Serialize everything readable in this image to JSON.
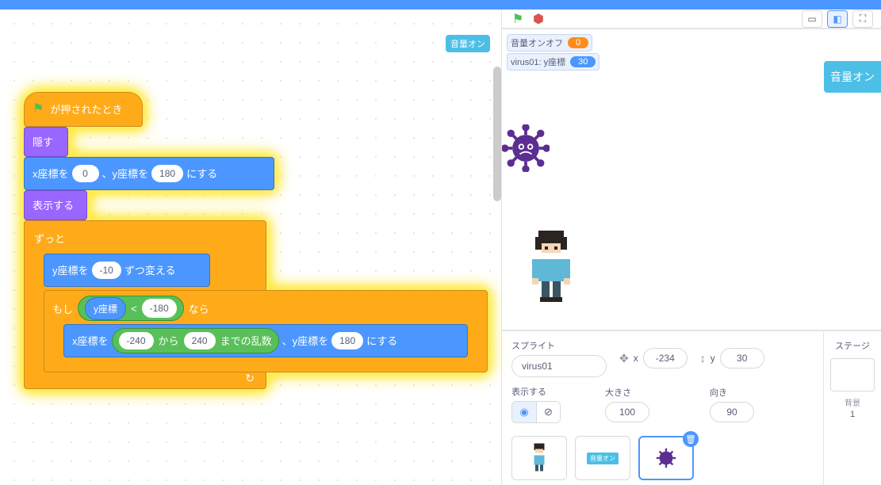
{
  "colors": {
    "motion": "#4C97FF",
    "looks": "#9966FF",
    "control": "#FFAB19",
    "operators": "#59C059",
    "highlight": "#FFE100",
    "accent": "#4CBFE6"
  },
  "script_area": {
    "sound_chip": "音量オン",
    "blocks": {
      "hat_label": "が押されたとき",
      "hide_label": "隠す",
      "goto_prefix": "x座標を",
      "goto_x": "0",
      "goto_mid": "、y座標を",
      "goto_y": "180",
      "goto_suffix": "にする",
      "show_label": "表示する",
      "forever_label": "ずっと",
      "change_y_prefix": "y座標を",
      "change_y_val": "-10",
      "change_y_suffix": "ずつ変える",
      "if_prefix": "もし",
      "if_suffix": "なら",
      "lt_left_label": "y座標",
      "lt_op": "<",
      "lt_right": "-180",
      "goto2_prefix": "x座標を",
      "rand_a": "-240",
      "rand_mid": "から",
      "rand_b": "240",
      "rand_suffix": "までの乱数",
      "goto2_mid": "、y座標を",
      "goto2_y": "180",
      "goto2_suffix": "にする"
    }
  },
  "stage_header": {
    "size_buttons": [
      "small",
      "normal",
      "full"
    ]
  },
  "monitors": {
    "sound_toggle_label": "音量オンオフ",
    "sound_toggle_value": "0",
    "virus_y_label": "virus01: y座標",
    "virus_y_value": "30",
    "sound_button": "音量オン"
  },
  "sprite_panel": {
    "sprite_label": "スプライト",
    "sprite_name": "virus01",
    "x_label": "x",
    "x_value": "-234",
    "y_label": "y",
    "y_value": "30",
    "show_label": "表示する",
    "size_label": "大きさ",
    "size_value": "100",
    "direction_label": "向き",
    "direction_value": "90",
    "thumbs": [
      {
        "name": "player"
      },
      {
        "name": "音量オン"
      },
      {
        "name": "virus01"
      }
    ]
  },
  "stage_panel": {
    "label": "ステージ",
    "backdrop_label": "背景",
    "backdrop_count": "1"
  }
}
